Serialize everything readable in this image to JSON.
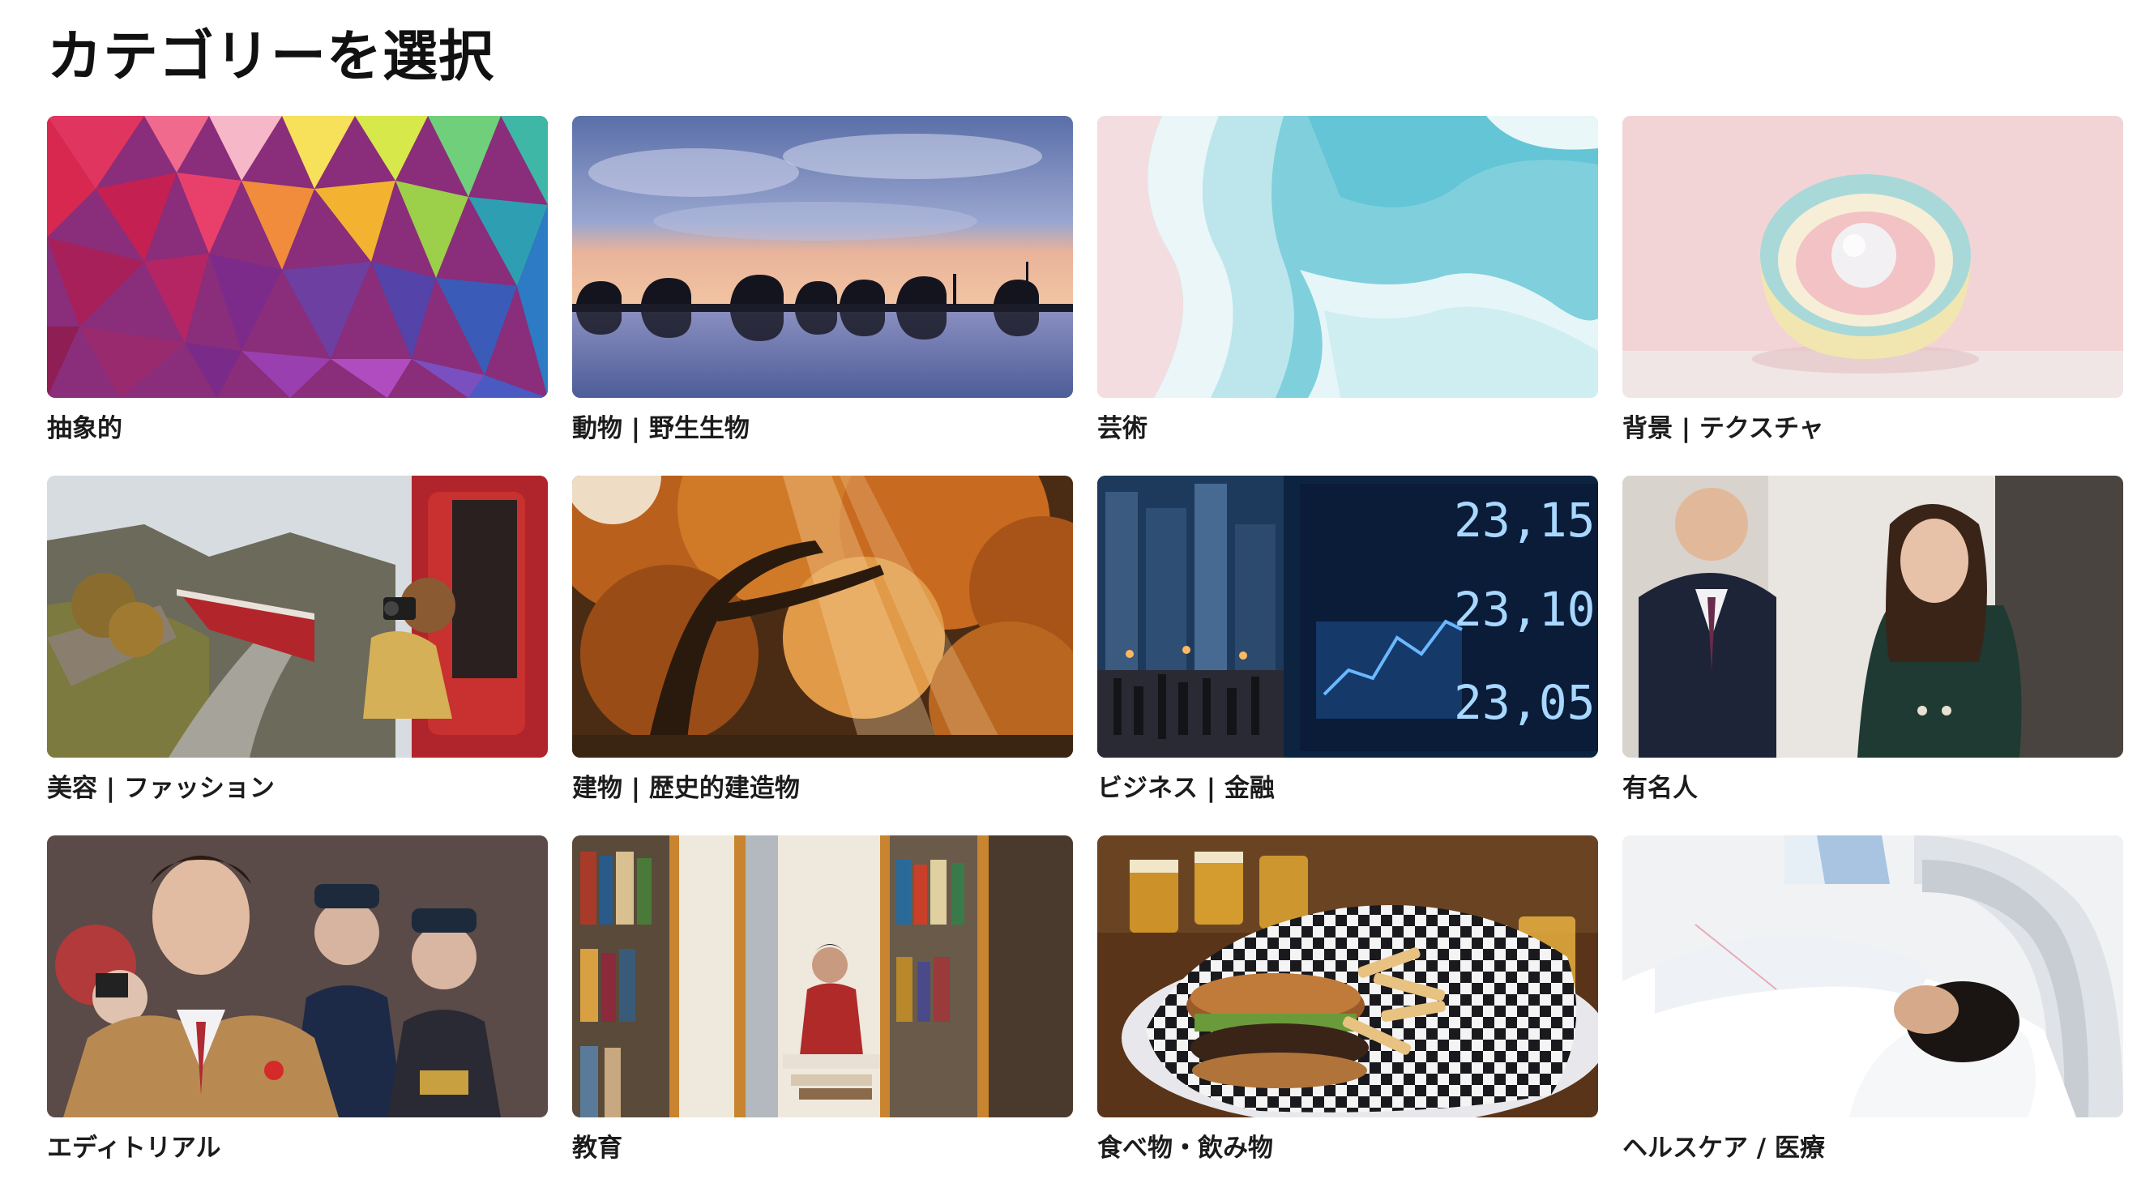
{
  "page": {
    "title": "カテゴリーを選択"
  },
  "categories": [
    {
      "label": "抽象的",
      "icon": "abstract-polygon-image"
    },
    {
      "label": "動物 | 野生生物",
      "icon": "elephants-silhouette-image"
    },
    {
      "label": "芸術",
      "icon": "ocean-waves-aerial-image"
    },
    {
      "label": "背景 | テクスチャ",
      "icon": "pastel-sphere-image"
    },
    {
      "label": "美容 | ファッション",
      "icon": "train-photographer-image"
    },
    {
      "label": "建物 | 歴史的建造物",
      "icon": "autumn-tree-image"
    },
    {
      "label": "ビジネス | 金融",
      "icon": "stock-ticker-city-image"
    },
    {
      "label": "有名人",
      "icon": "celebrity-couple-image"
    },
    {
      "label": "エディトリアル",
      "icon": "politician-ceremony-image"
    },
    {
      "label": "教育",
      "icon": "library-reader-image"
    },
    {
      "label": "食べ物・飲み物",
      "icon": "burger-beer-image"
    },
    {
      "label": "ヘルスケア / 医療",
      "icon": "mri-scan-image"
    }
  ],
  "colors": {
    "title": "#111111",
    "label": "#1c1c1c",
    "background": "#ffffff"
  }
}
